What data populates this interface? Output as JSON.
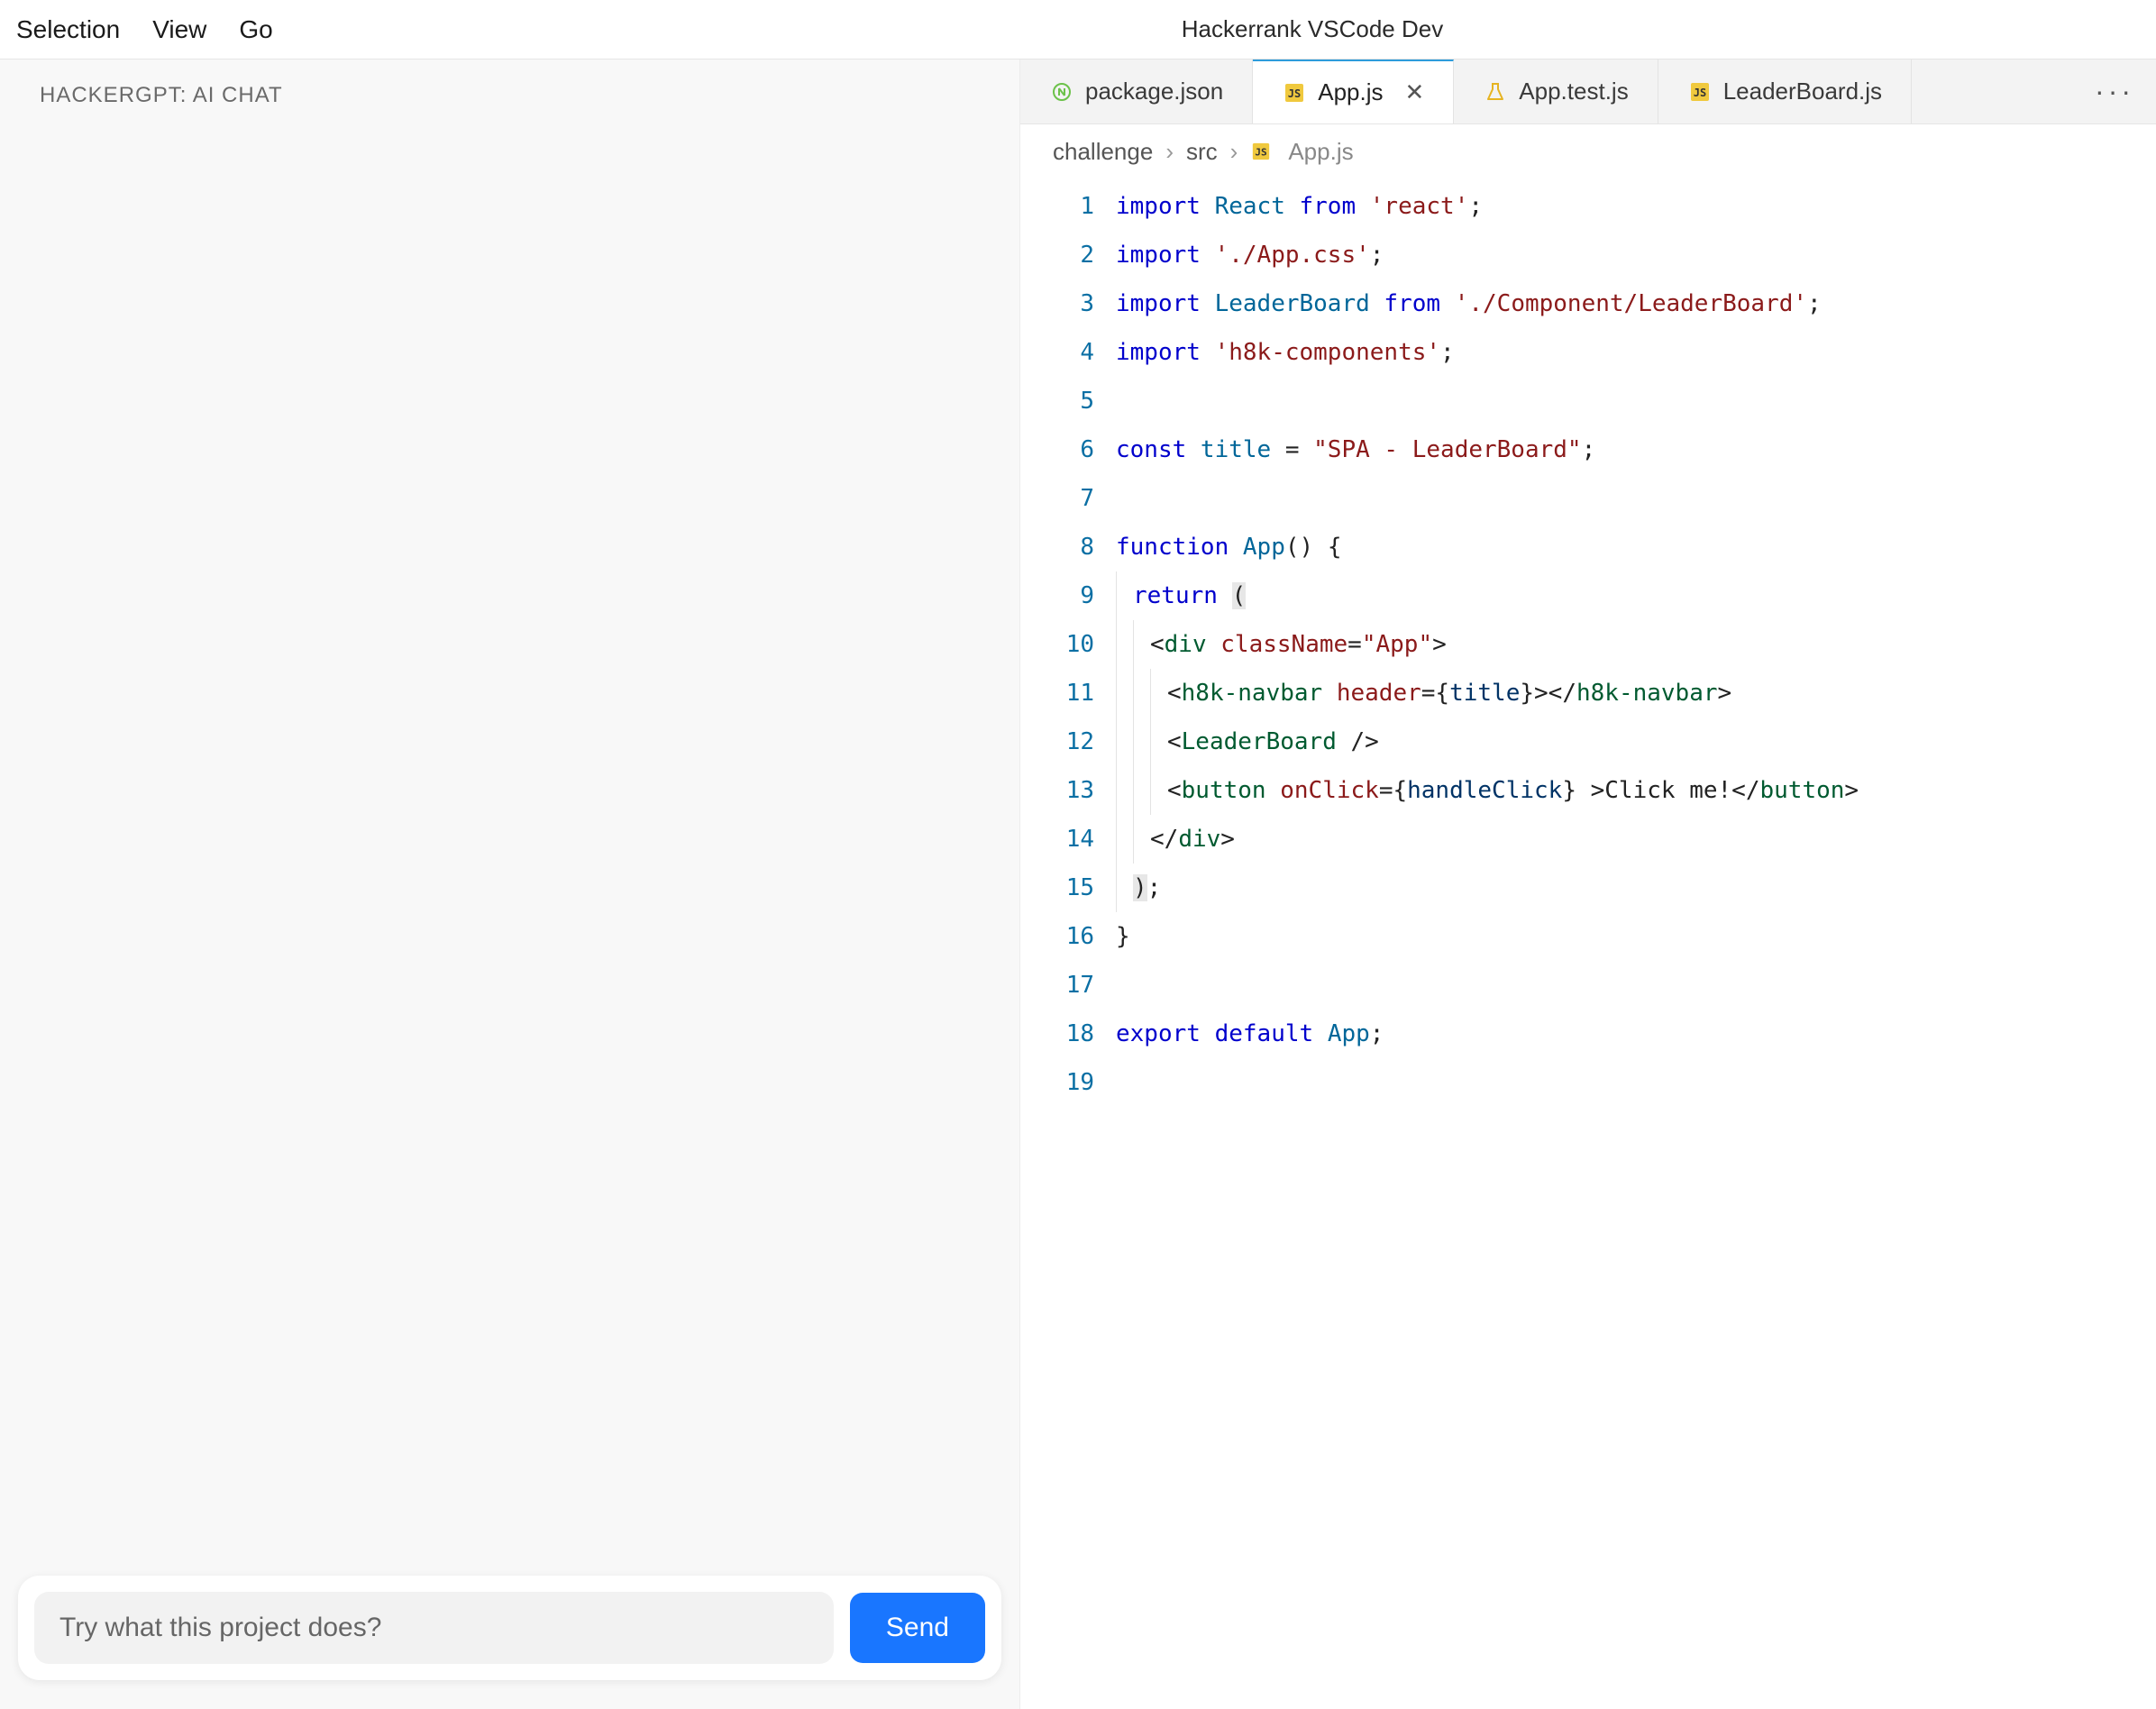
{
  "menubar": {
    "items": [
      "Selection",
      "View",
      "Go"
    ],
    "window_title": "Hackerrank VSCode Dev"
  },
  "chat": {
    "title": "HACKERGPT: AI CHAT",
    "placeholder": "Try what this project does?",
    "send_label": "Send"
  },
  "tabs": [
    {
      "label": "package.json",
      "icon": "npm",
      "active": false,
      "closeable": false
    },
    {
      "label": "App.js",
      "icon": "js",
      "active": true,
      "closeable": true
    },
    {
      "label": "App.test.js",
      "icon": "test",
      "active": false,
      "closeable": false
    },
    {
      "label": "LeaderBoard.js",
      "icon": "js",
      "active": false,
      "closeable": false
    }
  ],
  "tab_overflow": "···",
  "breadcrumbs": {
    "segments": [
      "challenge",
      "src",
      "App.js"
    ],
    "last_icon": "js"
  },
  "code": {
    "line_count": 19,
    "tokens": [
      [
        {
          "t": "import ",
          "c": "kw"
        },
        {
          "t": "React ",
          "c": "def"
        },
        {
          "t": "from ",
          "c": "kw"
        },
        {
          "t": "'react'",
          "c": "str"
        },
        {
          "t": ";",
          "c": "punc"
        }
      ],
      [
        {
          "t": "import ",
          "c": "kw"
        },
        {
          "t": "'./App.css'",
          "c": "str"
        },
        {
          "t": ";",
          "c": "punc"
        }
      ],
      [
        {
          "t": "import ",
          "c": "kw"
        },
        {
          "t": "LeaderBoard ",
          "c": "def"
        },
        {
          "t": "from ",
          "c": "kw"
        },
        {
          "t": "'./Component/LeaderBoard'",
          "c": "str"
        },
        {
          "t": ";",
          "c": "punc"
        }
      ],
      [
        {
          "t": "import ",
          "c": "kw"
        },
        {
          "t": "'h8k-components'",
          "c": "str"
        },
        {
          "t": ";",
          "c": "punc"
        }
      ],
      [],
      [
        {
          "t": "const ",
          "c": "kw"
        },
        {
          "t": "title ",
          "c": "def"
        },
        {
          "t": "= ",
          "c": "op"
        },
        {
          "t": "\"SPA - LeaderBoard\"",
          "c": "str"
        },
        {
          "t": ";",
          "c": "punc"
        }
      ],
      [],
      [
        {
          "t": "function ",
          "c": "kw"
        },
        {
          "t": "App",
          "c": "def"
        },
        {
          "t": "() {",
          "c": "punc"
        }
      ],
      [
        {
          "t": "  ",
          "c": "ind"
        },
        {
          "t": "return ",
          "c": "kw"
        },
        {
          "t": "(",
          "c": "punc",
          "hl": true
        }
      ],
      [
        {
          "t": "    ",
          "c": "ind"
        },
        {
          "t": "<",
          "c": "punc"
        },
        {
          "t": "div ",
          "c": "tag"
        },
        {
          "t": "className",
          "c": "attr"
        },
        {
          "t": "=",
          "c": "punc"
        },
        {
          "t": "\"App\"",
          "c": "str"
        },
        {
          "t": ">",
          "c": "punc"
        }
      ],
      [
        {
          "t": "      ",
          "c": "ind"
        },
        {
          "t": "<",
          "c": "punc"
        },
        {
          "t": "h8k-navbar ",
          "c": "tag"
        },
        {
          "t": "header",
          "c": "attr"
        },
        {
          "t": "={",
          "c": "punc"
        },
        {
          "t": "title",
          "c": "id"
        },
        {
          "t": "}>",
          "c": "punc"
        },
        {
          "t": "</",
          "c": "punc"
        },
        {
          "t": "h8k-navbar",
          "c": "tag"
        },
        {
          "t": ">",
          "c": "punc"
        }
      ],
      [
        {
          "t": "      ",
          "c": "ind"
        },
        {
          "t": "<",
          "c": "punc"
        },
        {
          "t": "LeaderBoard ",
          "c": "tag"
        },
        {
          "t": "/>",
          "c": "punc"
        }
      ],
      [
        {
          "t": "      ",
          "c": "ind"
        },
        {
          "t": "<",
          "c": "punc"
        },
        {
          "t": "button ",
          "c": "tag"
        },
        {
          "t": "onClick",
          "c": "attr"
        },
        {
          "t": "={",
          "c": "punc"
        },
        {
          "t": "handleClick",
          "c": "id"
        },
        {
          "t": "} >",
          "c": "punc"
        },
        {
          "t": "Click me!",
          "c": "punc"
        },
        {
          "t": "</",
          "c": "punc"
        },
        {
          "t": "button",
          "c": "tag"
        },
        {
          "t": ">",
          "c": "punc"
        }
      ],
      [
        {
          "t": "    ",
          "c": "ind"
        },
        {
          "t": "</",
          "c": "punc"
        },
        {
          "t": "div",
          "c": "tag"
        },
        {
          "t": ">",
          "c": "punc"
        }
      ],
      [
        {
          "t": "  ",
          "c": "ind"
        },
        {
          "t": ")",
          "c": "punc",
          "hl": true
        },
        {
          "t": ";",
          "c": "punc"
        }
      ],
      [
        {
          "t": "}",
          "c": "punc"
        }
      ],
      [],
      [
        {
          "t": "export ",
          "c": "kw"
        },
        {
          "t": "default ",
          "c": "kw"
        },
        {
          "t": "App",
          "c": "def"
        },
        {
          "t": ";",
          "c": "punc"
        }
      ],
      []
    ]
  }
}
